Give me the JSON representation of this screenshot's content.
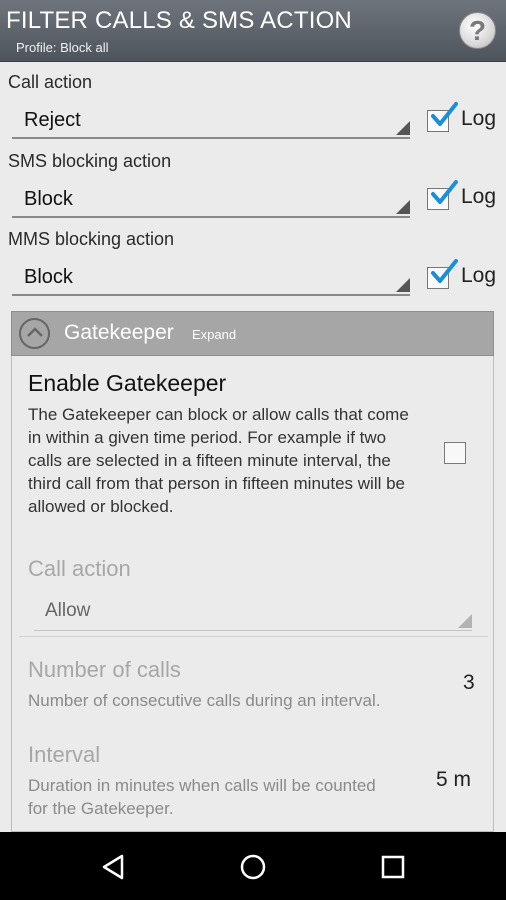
{
  "header": {
    "title": "FILTER CALLS & SMS ACTION",
    "subtitle": "Profile: Block all",
    "help_glyph": "?"
  },
  "call_action": {
    "label": "Call action",
    "value": "Reject",
    "log_label": "Log",
    "log_checked": true
  },
  "sms_action": {
    "label": "SMS blocking action",
    "value": "Block",
    "log_label": "Log",
    "log_checked": true
  },
  "mms_action": {
    "label": "MMS blocking action",
    "value": "Block",
    "log_label": "Log",
    "log_checked": true
  },
  "gatekeeper": {
    "title": "Gatekeeper",
    "expand_label": "Expand",
    "enable_title": "Enable Gatekeeper",
    "enable_desc": "The Gatekeeper can block or allow calls that come in within a given time period. For example if two calls are selected in a fifteen minute interval, the third call from that person in fifteen minutes will be allowed or blocked.",
    "enabled": false,
    "call_action_label": "Call action",
    "call_action_value": "Allow",
    "num_calls_label": "Number of calls",
    "num_calls_desc": "Number of consecutive calls during an interval.",
    "num_calls_value": "3",
    "interval_label": "Interval",
    "interval_desc": "Duration in minutes when calls will be counted for the Gatekeeper.",
    "interval_value": "5 m"
  },
  "colors": {
    "title_bar": "#5d636a",
    "check": "#1a8fd6",
    "gatekeeper_header": "#a6a6a6"
  },
  "icons": {
    "help": "help-icon",
    "collapse": "chevron-up-icon",
    "back": "back-icon",
    "home": "home-icon",
    "recents": "recents-icon"
  }
}
